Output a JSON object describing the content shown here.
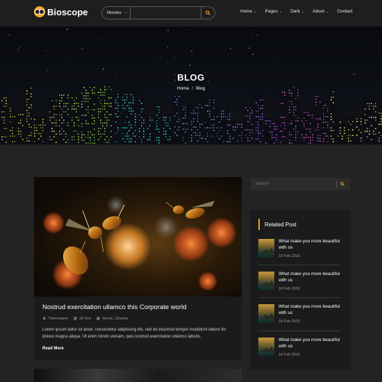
{
  "brand": {
    "name": "Bioscope"
  },
  "search": {
    "category": "Movies",
    "placeholder": ""
  },
  "nav": {
    "items": [
      {
        "label": "Home",
        "dropdown": true
      },
      {
        "label": "Pages",
        "dropdown": true
      },
      {
        "label": "Dark",
        "dropdown": true
      },
      {
        "label": "About",
        "dropdown": true
      },
      {
        "label": "Contact",
        "dropdown": false
      }
    ]
  },
  "hero": {
    "title": "BLOG",
    "breadcrumb": {
      "home": "Home",
      "separator": "/",
      "current": "Blog"
    }
  },
  "post": {
    "title": "Nostrud exercitation ullamco this Corporate world",
    "author": "Themelayer",
    "date": "28 Nov",
    "categories": "Movie, Cinema",
    "excerpt": "Lorem ipsum dolor sit amet, consectetur adipiscing elit, sed do eiusmod tempor incididunt labore for dolore magna aliqua. Ut enim minim veniam, quis nostrud exercitation ullamco laboris.",
    "read_more": "Read More"
  },
  "sidebar": {
    "search_placeholder": "Search",
    "related": {
      "heading": "Related Post",
      "items": [
        {
          "title": "What make you more beautiful with us",
          "date": "18 Feb 2019"
        },
        {
          "title": "What make you more beautiful with us",
          "date": "18 Feb 2019"
        },
        {
          "title": "What make you more beautiful with us",
          "date": "18 Feb 2019"
        },
        {
          "title": "What make you more beautiful with us",
          "date": "18 Feb 2019"
        }
      ]
    }
  },
  "colors": {
    "accent": "#f5a623",
    "background": "#232323",
    "card": "#1b1b1b",
    "header": "#1e1e1e"
  }
}
